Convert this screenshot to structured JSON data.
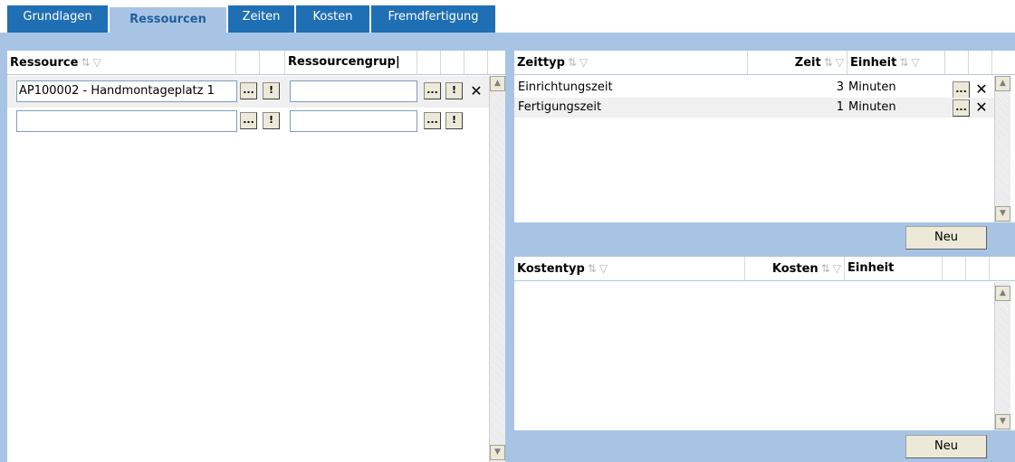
{
  "tabs": [
    {
      "label": "Grundlagen"
    },
    {
      "label": "Ressourcen"
    },
    {
      "label": "Zeiten"
    },
    {
      "label": "Kosten"
    },
    {
      "label": "Fremdfertigung"
    }
  ],
  "resources": {
    "headers": {
      "resource": "Ressource",
      "group": "Ressourcengrup|"
    },
    "rows": [
      {
        "resource": "AP100002 - Handmontageplatz 1",
        "group": ""
      },
      {
        "resource": "",
        "group": ""
      }
    ]
  },
  "times": {
    "headers": {
      "type": "Zeittyp",
      "time": "Zeit",
      "unit": "Einheit"
    },
    "rows": [
      {
        "type": "Einrichtungszeit",
        "value": "3",
        "unit": "Minuten"
      },
      {
        "type": "Fertigungszeit",
        "value": "1",
        "unit": "Minuten"
      }
    ],
    "new_label": "Neu"
  },
  "costs": {
    "headers": {
      "type": "Kostentyp",
      "cost": "Kosten",
      "unit": "Einheit"
    },
    "new_label": "Neu"
  },
  "icons": {
    "sort": "⇅",
    "filter": "▽",
    "lookup": "...",
    "bang": "!",
    "delete": "✕"
  },
  "colors": {
    "tab_blue": "#1f6fb4",
    "strip_blue": "#a8c4e4"
  }
}
